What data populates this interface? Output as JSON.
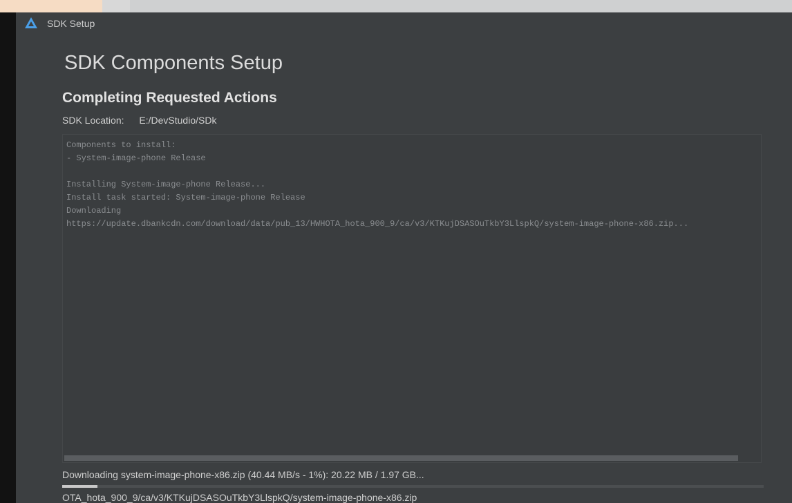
{
  "window": {
    "title": "SDK Setup",
    "icon": "deveco-triangle-icon",
    "accent_color": "#4a9fe8"
  },
  "page": {
    "title": "SDK Components Setup",
    "section_title": "Completing Requested Actions"
  },
  "sdk_location": {
    "label": "SDK Location:",
    "value": "E:/DevStudio/SDk"
  },
  "log": {
    "lines": [
      "Components to install:",
      "- System-image-phone Release",
      "",
      "Installing System-image-phone Release...",
      "Install task started: System-image-phone Release",
      "Downloading",
      "https://update.dbankcdn.com/download/data/pub_13/HWHOTA_hota_900_9/ca/v3/KTKujDSASOuTkbY3LlspkQ/system-image-phone-x86.zip..."
    ]
  },
  "status": {
    "text": "Downloading system-image-phone-x86.zip (40.44 MB/s - 1%): 20.22 MB / 1.97 GB...",
    "progress_percent": 5,
    "detail": "OTA_hota_900_9/ca/v3/KTKujDSASOuTkbY3LlspkQ/system-image-phone-x86.zip"
  }
}
